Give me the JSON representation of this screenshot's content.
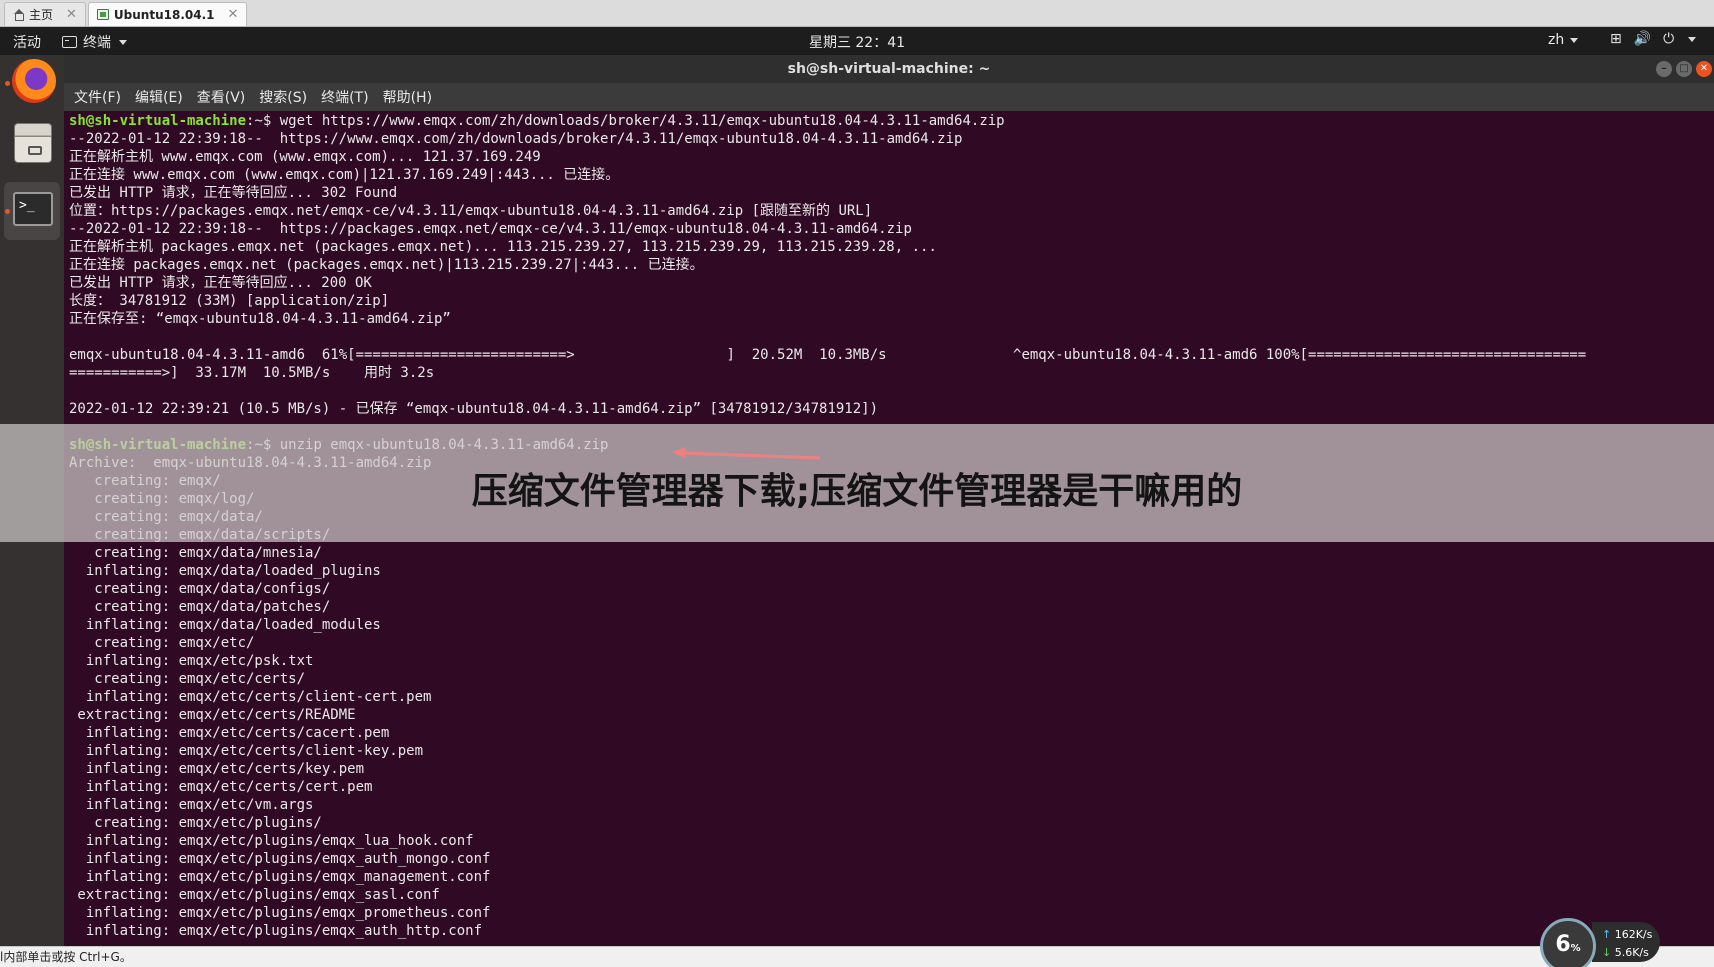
{
  "host_tabs": [
    {
      "label": "主页",
      "active": false
    },
    {
      "label": "Ubuntu18.04.1",
      "active": true
    }
  ],
  "topbar": {
    "activities": "活动",
    "app_name": "终端",
    "clock": "星期三 22：41",
    "lang": "zh"
  },
  "window": {
    "title": "sh@sh-virtual-machine: ~",
    "menu": [
      "文件(F)",
      "编辑(E)",
      "查看(V)",
      "搜索(S)",
      "终端(T)",
      "帮助(H)"
    ]
  },
  "terminal": {
    "prompt_user": "sh@sh-virtual-machine",
    "prompt_sep": ":~$ ",
    "lines": [
      {
        "cmd": "wget https://www.emqx.com/zh/downloads/broker/4.3.11/emqx-ubuntu18.04-4.3.11-amd64.zip"
      },
      {
        "text": "--2022-01-12 22:39:18--  https://www.emqx.com/zh/downloads/broker/4.3.11/emqx-ubuntu18.04-4.3.11-amd64.zip"
      },
      {
        "text": "正在解析主机 www.emqx.com (www.emqx.com)... 121.37.169.249"
      },
      {
        "text": "正在连接 www.emqx.com (www.emqx.com)|121.37.169.249|:443... 已连接。"
      },
      {
        "text": "已发出 HTTP 请求，正在等待回应... 302 Found"
      },
      {
        "text": "位置：https://packages.emqx.net/emqx-ce/v4.3.11/emqx-ubuntu18.04-4.3.11-amd64.zip [跟随至新的 URL]"
      },
      {
        "text": "--2022-01-12 22:39:18--  https://packages.emqx.net/emqx-ce/v4.3.11/emqx-ubuntu18.04-4.3.11-amd64.zip"
      },
      {
        "text": "正在解析主机 packages.emqx.net (packages.emqx.net)... 113.215.239.27, 113.215.239.29, 113.215.239.28, ..."
      },
      {
        "text": "正在连接 packages.emqx.net (packages.emqx.net)|113.215.239.27|:443... 已连接。"
      },
      {
        "text": "已发出 HTTP 请求，正在等待回应... 200 OK"
      },
      {
        "text": "长度： 34781912 (33M) [application/zip]"
      },
      {
        "text": "正在保存至: “emqx-ubuntu18.04-4.3.11-amd64.zip”"
      },
      {
        "text": ""
      },
      {
        "text": "emqx-ubuntu18.04-4.3.11-amd6  61%[=========================>                  ]  20.52M  10.3MB/s               ^emqx-ubuntu18.04-4.3.11-amd6 100%[================================="
      },
      {
        "text": "===========>]  33.17M  10.5MB/s    用时 3.2s"
      },
      {
        "text": ""
      },
      {
        "text": "2022-01-12 22:39:21 (10.5 MB/s) - 已保存 “emqx-ubuntu18.04-4.3.11-amd64.zip” [34781912/34781912])"
      },
      {
        "text": ""
      },
      {
        "cmd": "unzip emqx-ubuntu18.04-4.3.11-amd64.zip"
      },
      {
        "text": "Archive:  emqx-ubuntu18.04-4.3.11-amd64.zip"
      },
      {
        "text": "   creating: emqx/"
      },
      {
        "text": "   creating: emqx/log/"
      },
      {
        "text": "   creating: emqx/data/"
      },
      {
        "text": "   creating: emqx/data/scripts/"
      },
      {
        "text": "   creating: emqx/data/mnesia/"
      },
      {
        "text": "  inflating: emqx/data/loaded_plugins"
      },
      {
        "text": "   creating: emqx/data/configs/"
      },
      {
        "text": "   creating: emqx/data/patches/"
      },
      {
        "text": "  inflating: emqx/data/loaded_modules"
      },
      {
        "text": "   creating: emqx/etc/"
      },
      {
        "text": "  inflating: emqx/etc/psk.txt"
      },
      {
        "text": "   creating: emqx/etc/certs/"
      },
      {
        "text": "  inflating: emqx/etc/certs/client-cert.pem"
      },
      {
        "text": " extracting: emqx/etc/certs/README"
      },
      {
        "text": "  inflating: emqx/etc/certs/cacert.pem"
      },
      {
        "text": "  inflating: emqx/etc/certs/client-key.pem"
      },
      {
        "text": "  inflating: emqx/etc/certs/key.pem"
      },
      {
        "text": "  inflating: emqx/etc/certs/cert.pem"
      },
      {
        "text": "  inflating: emqx/etc/vm.args"
      },
      {
        "text": "   creating: emqx/etc/plugins/"
      },
      {
        "text": "  inflating: emqx/etc/plugins/emqx_lua_hook.conf"
      },
      {
        "text": "  inflating: emqx/etc/plugins/emqx_auth_mongo.conf"
      },
      {
        "text": "  inflating: emqx/etc/plugins/emqx_management.conf"
      },
      {
        "text": " extracting: emqx/etc/plugins/emqx_sasl.conf"
      },
      {
        "text": "  inflating: emqx/etc/plugins/emqx_prometheus.conf"
      },
      {
        "text": "  inflating: emqx/etc/plugins/emqx_auth_http.conf"
      }
    ]
  },
  "banner": {
    "text": "压缩文件管理器下载;压缩文件管理器是干嘛用的"
  },
  "statusbar": {
    "text": "l内部单击或按 Ctrl+G。"
  },
  "network_widget": {
    "percent": "6",
    "percent_unit": "%",
    "upload": "162",
    "download": "5.6",
    "rate_unit": "K/s"
  },
  "colors": {
    "terminal_bg": "#300a24",
    "prompt": "#8ae234",
    "accent": "#e95420"
  },
  "icons": [
    "home-icon",
    "vm-icon",
    "terminal-icon",
    "caret-down-icon",
    "network-icon",
    "volume-icon",
    "power-icon",
    "firefox-icon",
    "files-icon",
    "app-grid-icon",
    "minimize-icon",
    "maximize-icon",
    "close-icon"
  ]
}
